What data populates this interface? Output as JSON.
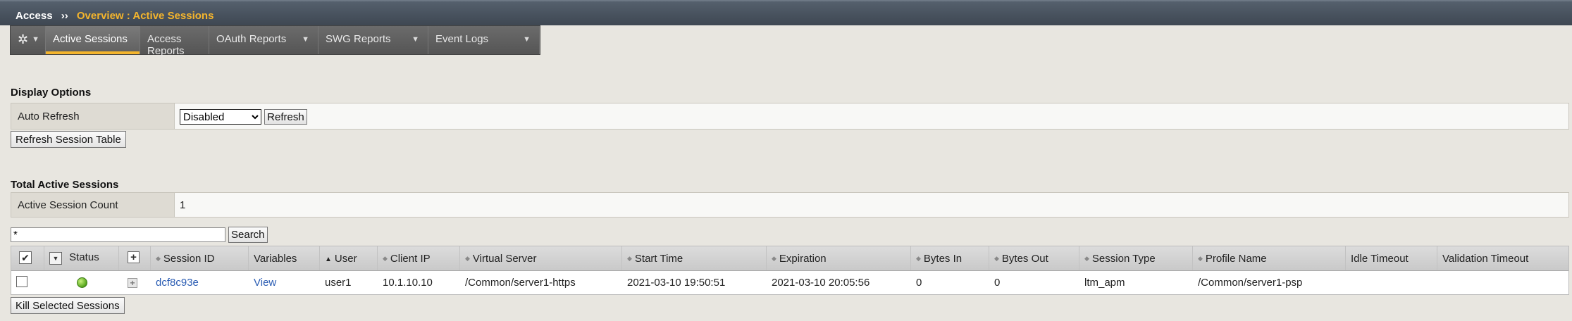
{
  "titlebar": {
    "section": "Access",
    "separator": "››",
    "breadcrumb": "Overview : Active Sessions"
  },
  "tabs": [
    {
      "label": "Active Sessions",
      "active": true,
      "dropdown": false
    },
    {
      "label": "Access Reports",
      "active": false,
      "dropdown": false
    },
    {
      "label": "OAuth Reports",
      "active": false,
      "dropdown": true
    },
    {
      "label": "SWG Reports",
      "active": false,
      "dropdown": true
    },
    {
      "label": "Event Logs",
      "active": false,
      "dropdown": true
    }
  ],
  "display_options": {
    "title": "Display Options",
    "auto_refresh_label": "Auto Refresh",
    "auto_refresh_value": "Disabled",
    "refresh_button": "Refresh",
    "refresh_table_button": "Refresh Session Table"
  },
  "total_sessions": {
    "title": "Total Active Sessions",
    "count_label": "Active Session Count",
    "count_value": "1"
  },
  "search": {
    "value": "*",
    "button": "Search"
  },
  "grid": {
    "columns": [
      "Status",
      "Session ID",
      "Variables",
      "User",
      "Client IP",
      "Virtual Server",
      "Start Time",
      "Expiration",
      "Bytes In",
      "Bytes Out",
      "Session Type",
      "Profile Name",
      "Idle Timeout",
      "Validation Timeout"
    ],
    "rows": [
      {
        "session_id": "dcf8c93e",
        "variables": "View",
        "user": "user1",
        "client_ip": "10.1.10.10",
        "virtual_server": "/Common/server1-https",
        "start_time": "2021-03-10 19:50:51",
        "expiration": "2021-03-10 20:05:56",
        "bytes_in": "0",
        "bytes_out": "0",
        "session_type": "ltm_apm",
        "profile_name": "/Common/server1-psp",
        "idle_timeout": "",
        "validation_timeout": ""
      }
    ]
  },
  "kill_button": "Kill Selected Sessions",
  "colors": {
    "accent": "#f4b52d",
    "status_ok": "#55a51b",
    "link": "#2a5cb3"
  }
}
